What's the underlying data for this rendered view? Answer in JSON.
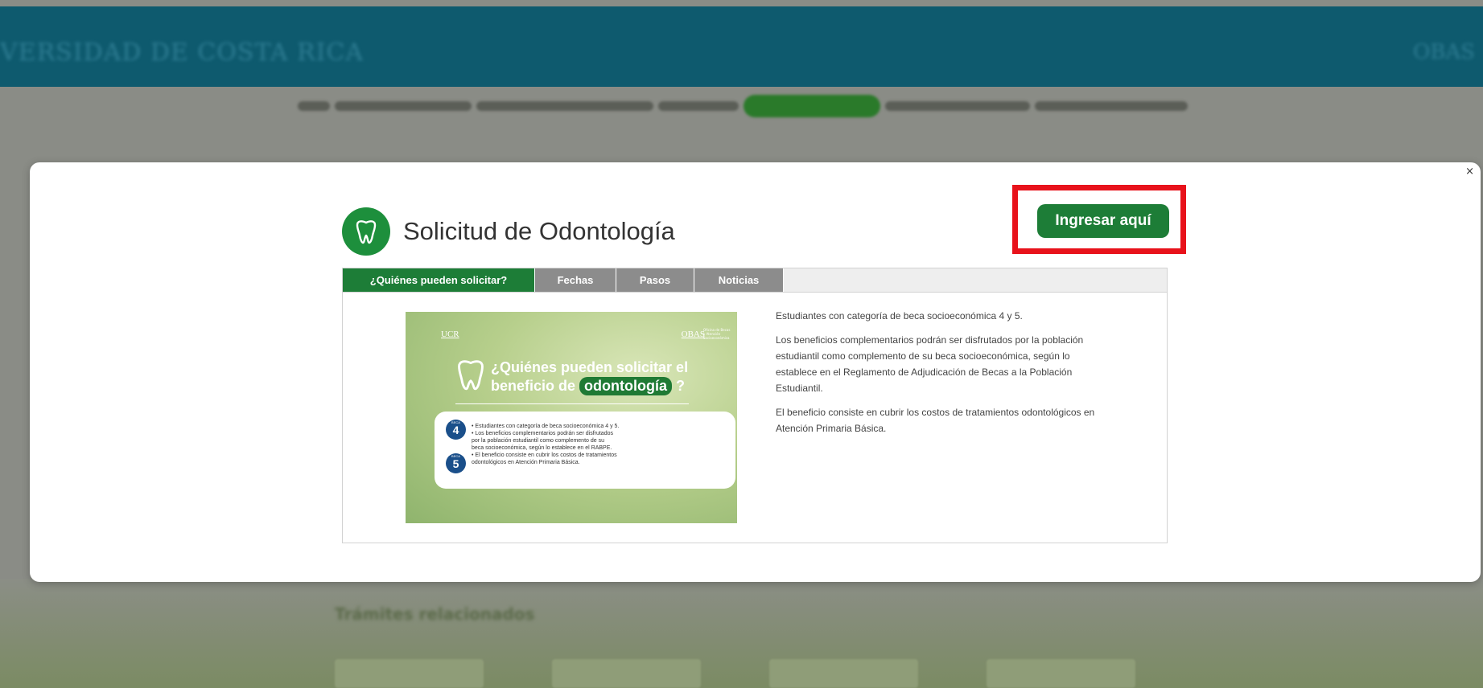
{
  "background": {
    "university_name": "VERSIDAD DE COSTA RICA",
    "logo_text": "OBAS",
    "related_heading": "Trámites relacionados"
  },
  "modal": {
    "close_label": "×",
    "title": "Solicitud de Odontología",
    "cta_label": "Ingresar aquí",
    "tabs": [
      {
        "label": "¿Quiénes pueden solicitar?",
        "active": true
      },
      {
        "label": "Fechas",
        "active": false
      },
      {
        "label": "Pasos",
        "active": false
      },
      {
        "label": "Noticias",
        "active": false
      }
    ],
    "infographic": {
      "ucr": "UCR",
      "obas": "OBAS",
      "obas_sub": "Oficina de Becas y Atención Socioeconómica",
      "head_line1": "¿Quiénes pueden solicitar el",
      "head_line2_pre": "beneficio de",
      "head_pill": "odontología",
      "head_line2_post": "?",
      "beca_label": "BECA",
      "beca_a": "4",
      "beca_b": "5",
      "bullets": [
        "• Estudiantes con categoría de beca socioeconómica 4 y 5.",
        "• Los beneficios complementarios podrán ser disfrutados",
        "  por la población estudiantil como complemento de su",
        "  beca socioeconómica, según lo establece en el RABPE.",
        "• El beneficio consiste en cubrir los costos de tratamientos",
        "  odontológicos en Atención Primaria Básica."
      ]
    },
    "description": [
      "Estudiantes con categoría de beca socioeconómica 4 y 5.",
      "Los beneficios complementarios podrán ser disfrutados por la población estudiantil como complemento de su beca socioeconómica, según lo establece en el Reglamento de Adjudicación de Becas a la Población Estudiantil.",
      "El beneficio consiste en cubrir los costos de tratamientos odontológicos en Atención Primaria Básica."
    ]
  },
  "colors": {
    "brand_green": "#1d7d37",
    "tab_inactive": "#8c8c8c",
    "highlight_red": "#e8121b",
    "header_teal": "#0e5a6e"
  }
}
